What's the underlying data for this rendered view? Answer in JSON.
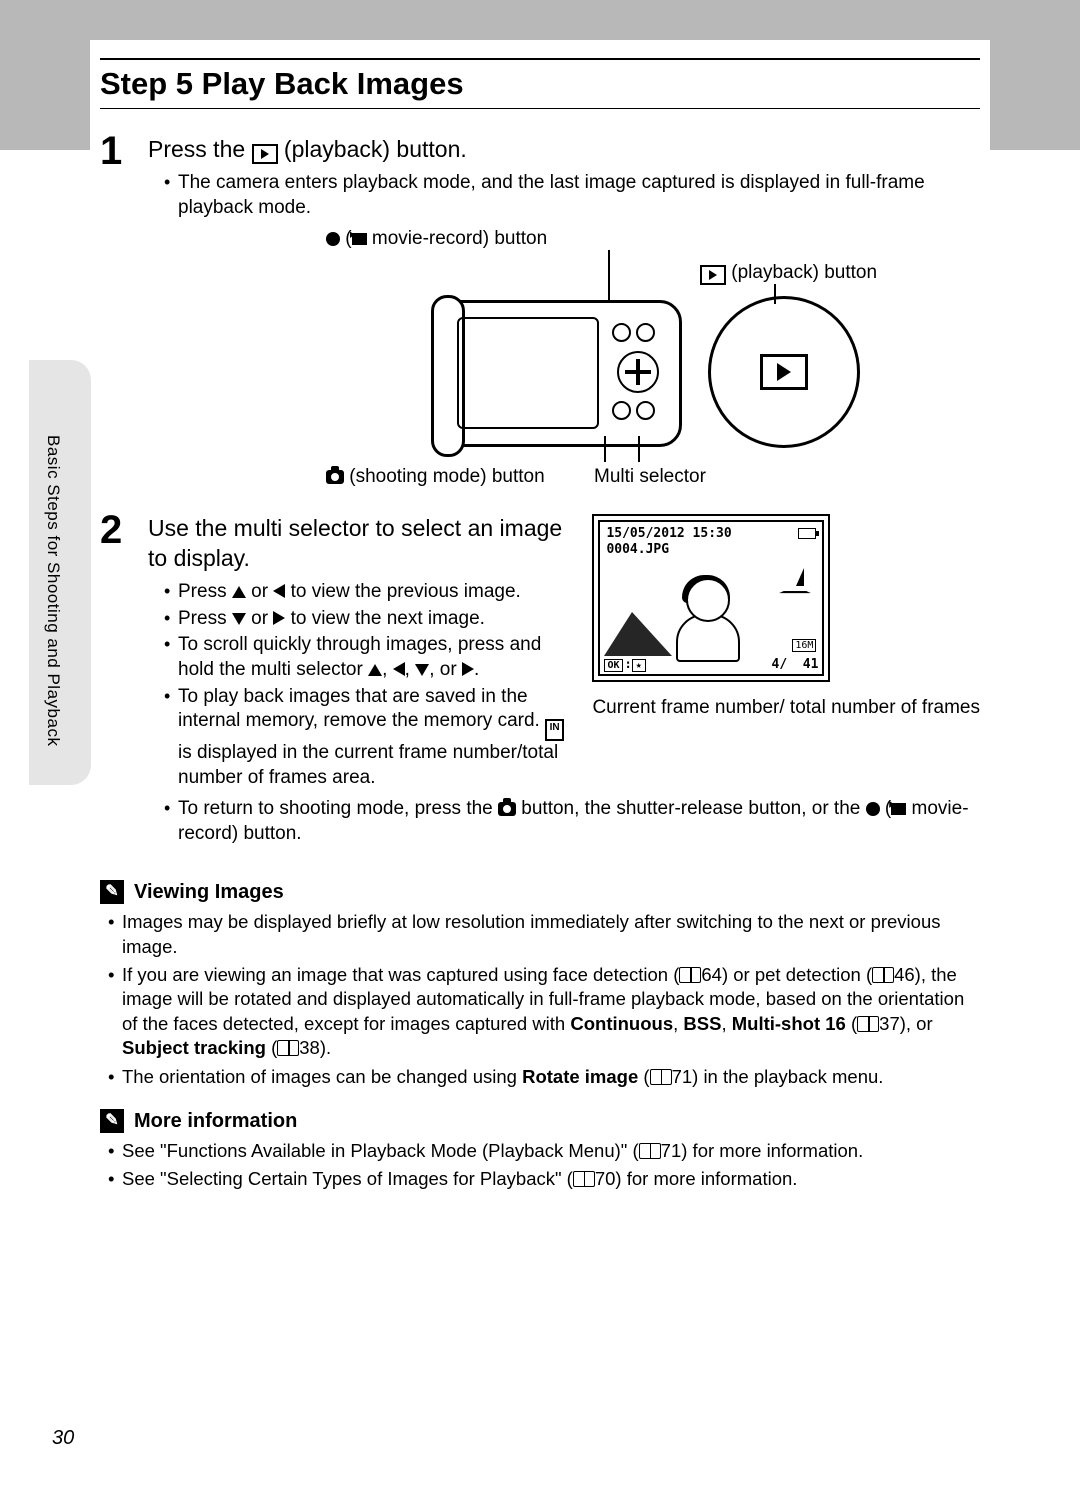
{
  "pageNumber": "30",
  "sideTab": "Basic Steps for Shooting and Playback",
  "title": "Step 5 Play Back Images",
  "step1": {
    "num": "1",
    "head_pre": "Press the ",
    "head_post": " (playback) button.",
    "bullet": "The camera enters playback mode, and the last image captured is displayed in full-frame playback mode."
  },
  "diagramLabels": {
    "movieRecord_pre": " (",
    "movieRecord_post": " movie-record) button",
    "playback": " (playback) button",
    "shooting": " (shooting mode) button",
    "multiSelector": "Multi selector"
  },
  "step2": {
    "num": "2",
    "head": "Use the multi selector to select an image to display.",
    "b1_pre": "Press ",
    "b1_mid": " or ",
    "b1_post": " to view the previous image.",
    "b2_pre": "Press ",
    "b2_mid": " or ",
    "b2_post": " to view the next image.",
    "b3_pre": "To scroll quickly through images, press and hold the multi selector ",
    "b3_sep": ", ",
    "b3_or": ", or ",
    "b3_end": ".",
    "b4_pre": "To play back images that are saved in the internal memory, remove the memory card. ",
    "b4_post": " is displayed in the current frame number/total number of frames area.",
    "b5_pre": "To return to shooting mode, press the ",
    "b5_mid": " button, the shutter-release button, or the ",
    "b5_paren_pre": " (",
    "b5_paren_post": " movie-record) button."
  },
  "lcd": {
    "datetime": "15/05/2012 15:30",
    "filename": "0004.JPG",
    "ok": "OK",
    "star": "★",
    "size": "16M",
    "current": "4",
    "sep": "/",
    "total": "41",
    "caption": "Current frame number/ total number of frames"
  },
  "viewing": {
    "title": "Viewing Images",
    "b1": "Images may be displayed briefly at low resolution immediately after switching to the next or previous image.",
    "b2_pre": "If you are viewing an image that was captured using face detection (",
    "b2_ref1": "64) or pet detection (",
    "b2_ref2": "46), the image will be rotated and displayed automatically in full-frame playback mode, based on the orientation of the faces detected, except for images captured with ",
    "b2_cont": "Continuous",
    "b2_c1": ", ",
    "b2_bss": "BSS",
    "b2_c2": ", ",
    "b2_ms": "Multi-shot 16",
    "b2_paren1": " (",
    "b2_ref3": "37), or ",
    "b2_st": "Subject tracking",
    "b2_paren2": " (",
    "b2_ref4": "38).",
    "b3_pre": "The orientation of images can be changed using ",
    "b3_ri": "Rotate image",
    "b3_paren": " (",
    "b3_ref": "71) in the playback menu."
  },
  "more": {
    "title": "More information",
    "b1_pre": "See \"Functions Available in Playback Mode (Playback Menu)\" (",
    "b1_post": "71) for more information.",
    "b2_pre": "See \"Selecting Certain Types of Images for Playback\" (",
    "b2_post": "70) for more information."
  }
}
